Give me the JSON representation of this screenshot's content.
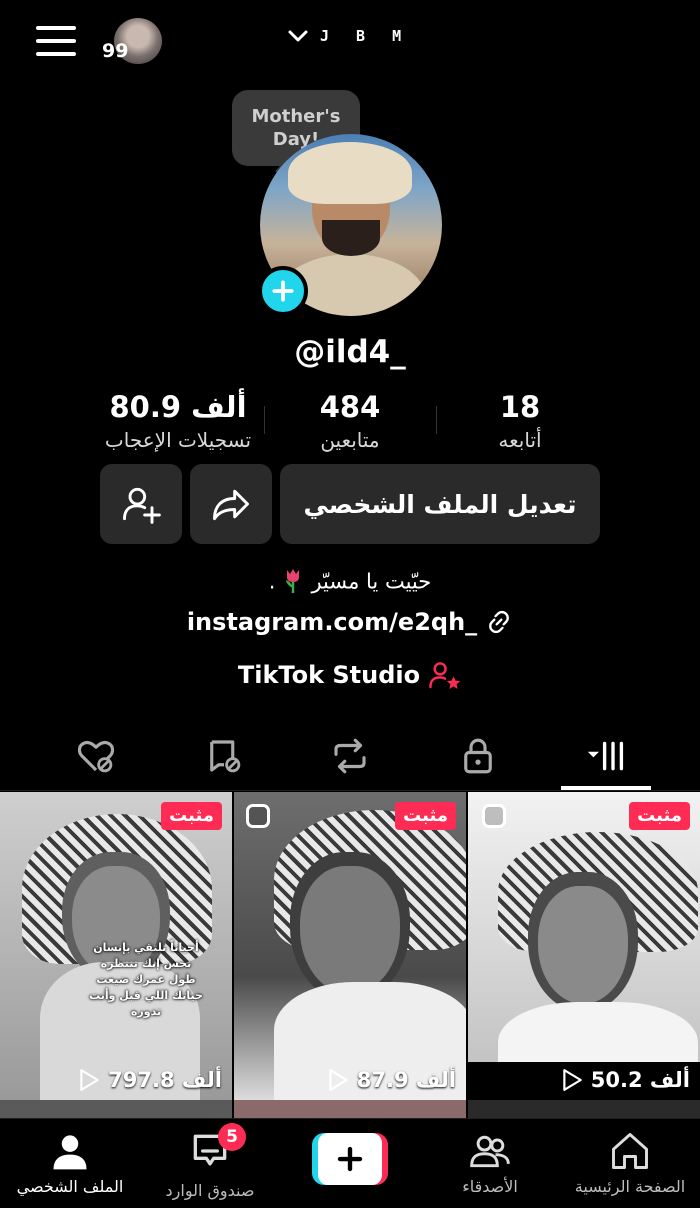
{
  "header": {
    "account_name": "J B M",
    "notification_count": "99",
    "icons": [
      "menu-icon",
      "chevron-down-icon"
    ]
  },
  "profile": {
    "bubble_text": "Mother's Day!",
    "username": "@ild4_",
    "stats": [
      {
        "value": "80.9 ألف",
        "label": "تسجيلات الإعجاب"
      },
      {
        "value": "484",
        "label": "متابعين"
      },
      {
        "value": "18",
        "label": "أتابعه"
      }
    ],
    "edit_button": "تعديل الملف الشخصي",
    "bio": "حيّيت يا مسيّر",
    "bio_suffix": ".",
    "link": "instagram.com/e2qh_",
    "studio": "TikTok Studio"
  },
  "tabs": [
    "videos-grid-icon",
    "lock-icon",
    "repost-icon",
    "tagged-hidden-icon",
    "liked-hidden-icon"
  ],
  "videos": [
    {
      "pinned": "مثبت",
      "views": "797.8 ألف",
      "caption": "أحياناً تلتقي بإنسان تحس إنك تنتظره طول عمرك ضيعت حياتك اللي قبل وأنت تدوره"
    },
    {
      "pinned": "مثبت",
      "views": "87.9 ألف"
    },
    {
      "pinned": "مثبت",
      "views": "50.2 ألف"
    }
  ],
  "bottom_nav": [
    {
      "label": "الصفحة الرئيسية",
      "icon": "home-icon"
    },
    {
      "label": "الأصدقاء",
      "icon": "friends-icon"
    },
    {
      "label": "",
      "icon": "plus-icon"
    },
    {
      "label": "صندوق الوارد",
      "icon": "inbox-icon",
      "badge": "5"
    },
    {
      "label": "الملف الشخصي",
      "icon": "profile-icon"
    }
  ],
  "colors": {
    "accent_pink": "#fe2c55",
    "accent_cyan": "#20d5ec",
    "background": "#000000"
  }
}
